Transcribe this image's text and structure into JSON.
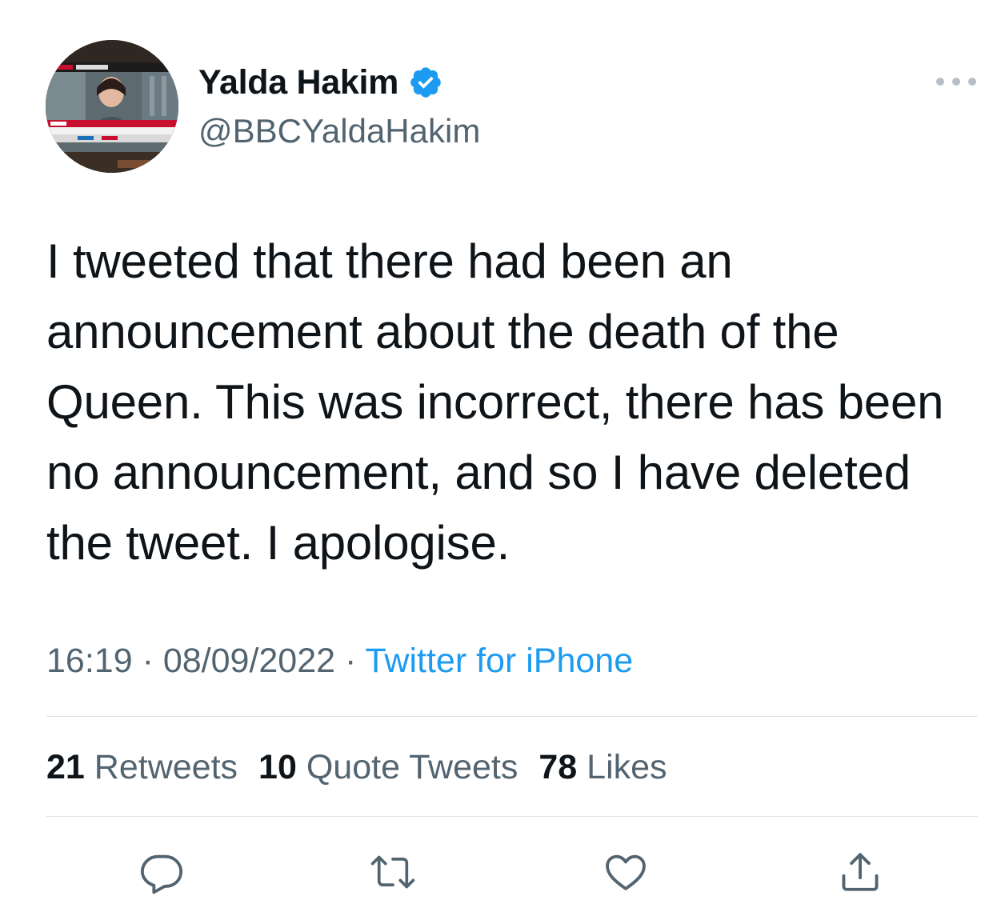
{
  "author": {
    "display_name": "Yalda Hakim",
    "handle": "@BBCYaldaHakim",
    "verified": true,
    "avatar_icon": "avatar-photo"
  },
  "tweet": {
    "text": "I tweeted that there had been an announcement about the death of the Queen. This was incorrect, there has been no announcement, and so I have deleted the tweet. I apologise.",
    "time": "16:19",
    "date": "08/09/2022",
    "separator": "·",
    "source": "Twitter for iPhone"
  },
  "stats": {
    "retweets_count": "21",
    "retweets_label": "Retweets",
    "quotes_count": "10",
    "quotes_label": "Quote Tweets",
    "likes_count": "78",
    "likes_label": "Likes"
  },
  "actions": {
    "reply_icon": "reply-icon",
    "retweet_icon": "retweet-icon",
    "like_icon": "heart-icon",
    "share_icon": "share-icon"
  },
  "colors": {
    "accent": "#1d9bf0",
    "text_primary": "#0f1419",
    "text_secondary": "#536471",
    "divider": "#dfe3e7"
  }
}
